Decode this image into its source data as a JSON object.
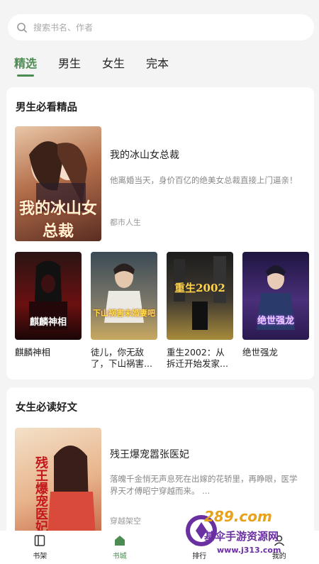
{
  "search": {
    "placeholder": "搜索书名、作者"
  },
  "tabs": [
    {
      "label": "精选",
      "active": true
    },
    {
      "label": "男生",
      "active": false
    },
    {
      "label": "女生",
      "active": false
    },
    {
      "label": "完本",
      "active": false
    }
  ],
  "section1": {
    "title": "男生必看精品",
    "featured": {
      "title": "我的冰山女总裁",
      "desc": "他离婚当天，身价百亿的绝美女总裁直接上门逼亲！",
      "tag": "都市人生",
      "cover_text": "我的冰山女总裁"
    },
    "books": [
      {
        "name": "麒麟神相",
        "cover_text": "麒麟神相"
      },
      {
        "name": "徒儿，你无敌了，下山祸害...",
        "cover_text": "下山祸害未婚妻吧"
      },
      {
        "name": "重生2002：从拆迁开始发家...",
        "cover_text": "重生2002"
      },
      {
        "name": "绝世强龙",
        "cover_text": "绝世强龙"
      }
    ]
  },
  "section2": {
    "title": "女生必读好文",
    "featured": {
      "title": "残王爆宠嚣张医妃",
      "desc": "落魄千金悄无声息死在出嫁的花轿里，再睁眼，医学界天才傅昭宁穿越而来。 ...",
      "tag": "穿越架空",
      "cover_text": "残王爆宠医妃"
    }
  },
  "nav": [
    {
      "label": "书架",
      "icon": "book-icon",
      "active": false
    },
    {
      "label": "书城",
      "icon": "home-icon",
      "active": true
    },
    {
      "label": "排行",
      "icon": "rank-icon",
      "active": false
    },
    {
      "label": "我的",
      "icon": "user-icon",
      "active": false
    }
  ],
  "watermark": {
    "logo": "289.com",
    "name": "基伞手游资源网",
    "url": "www.j313.com"
  },
  "colors": {
    "accent": "#4c8b52",
    "background": "#f4f4f4"
  }
}
